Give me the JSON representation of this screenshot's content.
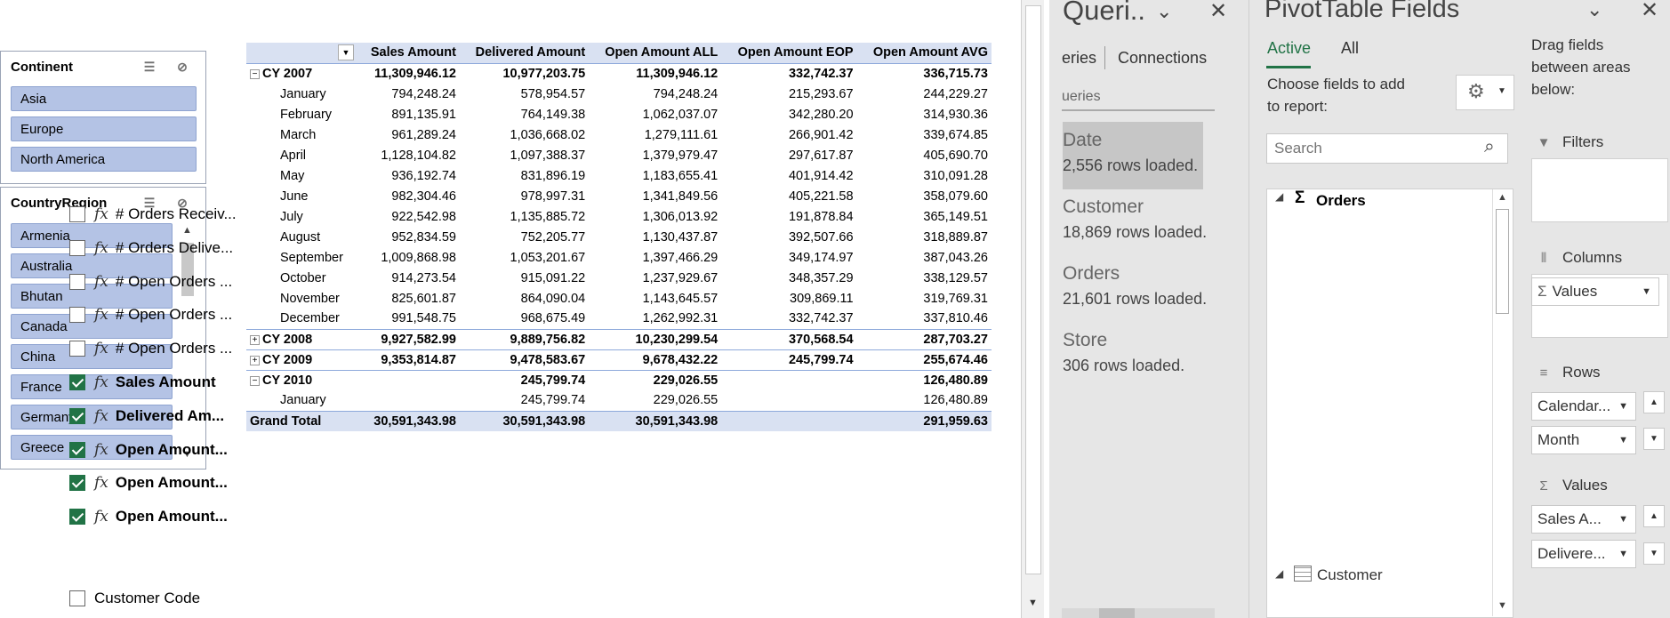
{
  "slicer_continent": {
    "title": "Continent",
    "items": [
      "Asia",
      "Europe",
      "North America"
    ]
  },
  "slicer_country": {
    "title": "CountryRegion",
    "items": [
      "Armenia",
      "Australia",
      "Bhutan",
      "Canada",
      "China",
      "France",
      "Germany",
      "Greece"
    ]
  },
  "pivot": {
    "headers": [
      "Sales Amount",
      "Delivered Amount",
      "Open Amount ALL",
      "Open Amount EOP",
      "Open Amount AVG"
    ],
    "rows": [
      {
        "type": "year",
        "label": "CY 2007",
        "sign": "−",
        "v": [
          "11,309,946.12",
          "10,977,203.75",
          "11,309,946.12",
          "332,742.37",
          "336,715.73"
        ]
      },
      {
        "type": "month",
        "label": "January",
        "v": [
          "794,248.24",
          "578,954.57",
          "794,248.24",
          "215,293.67",
          "244,229.27"
        ]
      },
      {
        "type": "month",
        "label": "February",
        "v": [
          "891,135.91",
          "764,149.38",
          "1,062,037.07",
          "342,280.20",
          "314,930.36"
        ]
      },
      {
        "type": "month",
        "label": "March",
        "v": [
          "961,289.24",
          "1,036,668.02",
          "1,279,111.61",
          "266,901.42",
          "339,674.85"
        ]
      },
      {
        "type": "month",
        "label": "April",
        "v": [
          "1,128,104.82",
          "1,097,388.37",
          "1,379,979.47",
          "297,617.87",
          "405,690.70"
        ]
      },
      {
        "type": "month",
        "label": "May",
        "v": [
          "936,192.74",
          "831,896.19",
          "1,183,655.41",
          "401,914.42",
          "310,091.28"
        ]
      },
      {
        "type": "month",
        "label": "June",
        "v": [
          "982,304.46",
          "978,997.31",
          "1,341,849.56",
          "405,221.58",
          "358,079.60"
        ]
      },
      {
        "type": "month",
        "label": "July",
        "v": [
          "922,542.98",
          "1,135,885.72",
          "1,306,013.92",
          "191,878.84",
          "365,149.51"
        ]
      },
      {
        "type": "month",
        "label": "August",
        "v": [
          "952,834.59",
          "752,205.77",
          "1,130,437.87",
          "392,507.66",
          "318,889.87"
        ]
      },
      {
        "type": "month",
        "label": "September",
        "v": [
          "1,009,868.98",
          "1,053,201.67",
          "1,397,466.29",
          "349,174.97",
          "387,043.26"
        ]
      },
      {
        "type": "month",
        "label": "October",
        "v": [
          "914,273.54",
          "915,091.22",
          "1,237,929.67",
          "348,357.29",
          "338,129.57"
        ]
      },
      {
        "type": "month",
        "label": "November",
        "v": [
          "825,601.87",
          "864,090.04",
          "1,143,645.57",
          "309,869.11",
          "319,769.31"
        ]
      },
      {
        "type": "month",
        "label": "December",
        "v": [
          "991,548.75",
          "968,675.49",
          "1,262,992.31",
          "332,742.37",
          "337,810.46"
        ]
      },
      {
        "type": "year",
        "label": "CY 2008",
        "sign": "+",
        "v": [
          "9,927,582.99",
          "9,889,756.82",
          "10,230,299.54",
          "370,568.54",
          "287,703.27"
        ]
      },
      {
        "type": "year",
        "label": "CY 2009",
        "sign": "+",
        "v": [
          "9,353,814.87",
          "9,478,583.67",
          "9,678,432.22",
          "245,799.74",
          "255,674.46"
        ]
      },
      {
        "type": "year",
        "label": "CY 2010",
        "sign": "−",
        "v": [
          "",
          "245,799.74",
          "229,026.55",
          "",
          "126,480.89"
        ]
      },
      {
        "type": "month",
        "label": "January",
        "v": [
          "",
          "245,799.74",
          "229,026.55",
          "",
          "126,480.89"
        ]
      },
      {
        "type": "total",
        "label": "Grand Total",
        "v": [
          "30,591,343.98",
          "30,591,343.98",
          "30,591,343.98",
          "",
          "291,959.63"
        ]
      }
    ]
  },
  "queries": {
    "title": "Queri..",
    "tab_queries": "eries",
    "tab_connections": "Connections",
    "subheader": "ueries",
    "items": [
      {
        "name": "Date",
        "status": "2,556 rows loaded."
      },
      {
        "name": "Customer",
        "status": "18,869 rows loaded."
      },
      {
        "name": "Orders",
        "status": "21,601 rows loaded."
      },
      {
        "name": "Store",
        "status": "306 rows loaded."
      }
    ]
  },
  "fields": {
    "title": "PivotTable Fields",
    "tab_active": "Active",
    "tab_all": "All",
    "choose_text": "Choose fields to add to report:",
    "search_placeholder": "Search",
    "table_orders": "Orders",
    "table_customer": "Customer",
    "items": [
      {
        "label": "# Orders Receiv...",
        "checked": false
      },
      {
        "label": "# Orders Delive...",
        "checked": false
      },
      {
        "label": "# Open Orders ...",
        "checked": false
      },
      {
        "label": "# Open Orders ...",
        "checked": false
      },
      {
        "label": "# Open Orders ...",
        "checked": false
      },
      {
        "label": "Sales Amount",
        "checked": true
      },
      {
        "label": "Delivered Am...",
        "checked": true
      },
      {
        "label": "Open Amount...",
        "checked": true
      },
      {
        "label": "Open Amount...",
        "checked": true
      },
      {
        "label": "Open Amount...",
        "checked": true
      }
    ],
    "customer_first": "Customer Code",
    "drag_text": "Drag fields between areas below:",
    "filters_label": "Filters",
    "columns_label": "Columns",
    "columns_value": "Values",
    "rows_label": "Rows",
    "rows_values": [
      "Calendar...",
      "Month"
    ],
    "values_label": "Values",
    "values_values": [
      "Sales A...",
      "Delivere..."
    ],
    "accent_color": "#217346"
  }
}
